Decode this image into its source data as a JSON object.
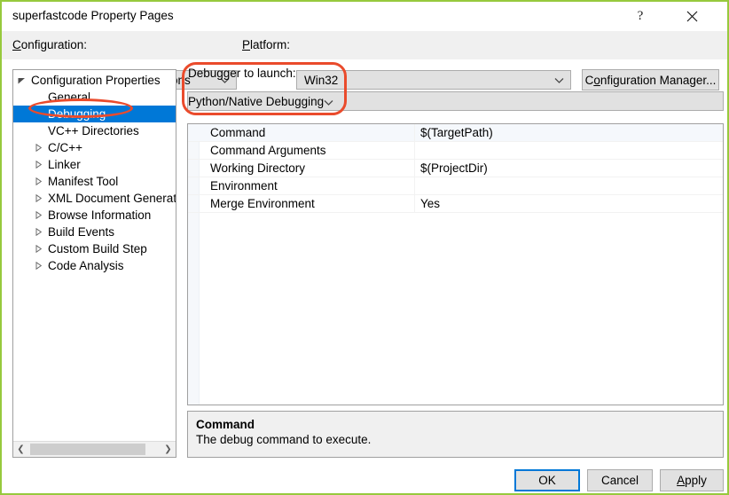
{
  "window": {
    "title": "superfastcode Property Pages",
    "help_icon": "?",
    "close_icon": "close-icon"
  },
  "config_bar": {
    "configuration_label": "Configuration:",
    "configuration_label_accel": "C",
    "configuration_label_rest": "onfiguration:",
    "configuration_value": "All Configurations",
    "platform_label_accel": "P",
    "platform_label_rest": "latform:",
    "platform_value": "Win32",
    "config_manager_accel_pre": "C",
    "config_manager_accel": "o",
    "config_manager_rest": "nfiguration Manager..."
  },
  "tree": {
    "items": [
      {
        "label": "Configuration Properties",
        "level": 0,
        "twisty": "expanded",
        "selected": false
      },
      {
        "label": "General",
        "level": 1,
        "twisty": "none",
        "selected": false
      },
      {
        "label": "Debugging",
        "level": 1,
        "twisty": "none",
        "selected": true
      },
      {
        "label": "VC++ Directories",
        "level": 1,
        "twisty": "none",
        "selected": false
      },
      {
        "label": "C/C++",
        "level": 1,
        "twisty": "collapsed",
        "selected": false
      },
      {
        "label": "Linker",
        "level": 1,
        "twisty": "collapsed",
        "selected": false
      },
      {
        "label": "Manifest Tool",
        "level": 1,
        "twisty": "collapsed",
        "selected": false
      },
      {
        "label": "XML Document Generator",
        "level": 1,
        "twisty": "collapsed",
        "selected": false
      },
      {
        "label": "Browse Information",
        "level": 1,
        "twisty": "collapsed",
        "selected": false
      },
      {
        "label": "Build Events",
        "level": 1,
        "twisty": "collapsed",
        "selected": false
      },
      {
        "label": "Custom Build Step",
        "level": 1,
        "twisty": "collapsed",
        "selected": false
      },
      {
        "label": "Code Analysis",
        "level": 1,
        "twisty": "collapsed",
        "selected": false
      }
    ],
    "scroll_left_icon": "❮",
    "scroll_right_icon": "❯"
  },
  "debugger": {
    "label": "Debugger to launch:",
    "value": "Python/Native Debugging"
  },
  "properties": {
    "rows": [
      {
        "name": "Command",
        "value": "$(TargetPath)",
        "selected": true
      },
      {
        "name": "Command Arguments",
        "value": "",
        "selected": false
      },
      {
        "name": "Working Directory",
        "value": "$(ProjectDir)",
        "selected": false
      },
      {
        "name": "Environment",
        "value": "",
        "selected": false
      },
      {
        "name": "Merge Environment",
        "value": "Yes",
        "selected": false
      }
    ]
  },
  "description": {
    "title": "Command",
    "text": "The debug command to execute."
  },
  "footer": {
    "ok": "OK",
    "cancel": "Cancel",
    "apply_accel": "A",
    "apply_rest": "pply"
  },
  "colors": {
    "selection_blue": "#0078d7",
    "annotation_red": "#ea4b2c",
    "window_border_green": "#97c93d",
    "dialog_gray": "#f0f0f0",
    "control_gray": "#e1e1e1"
  }
}
